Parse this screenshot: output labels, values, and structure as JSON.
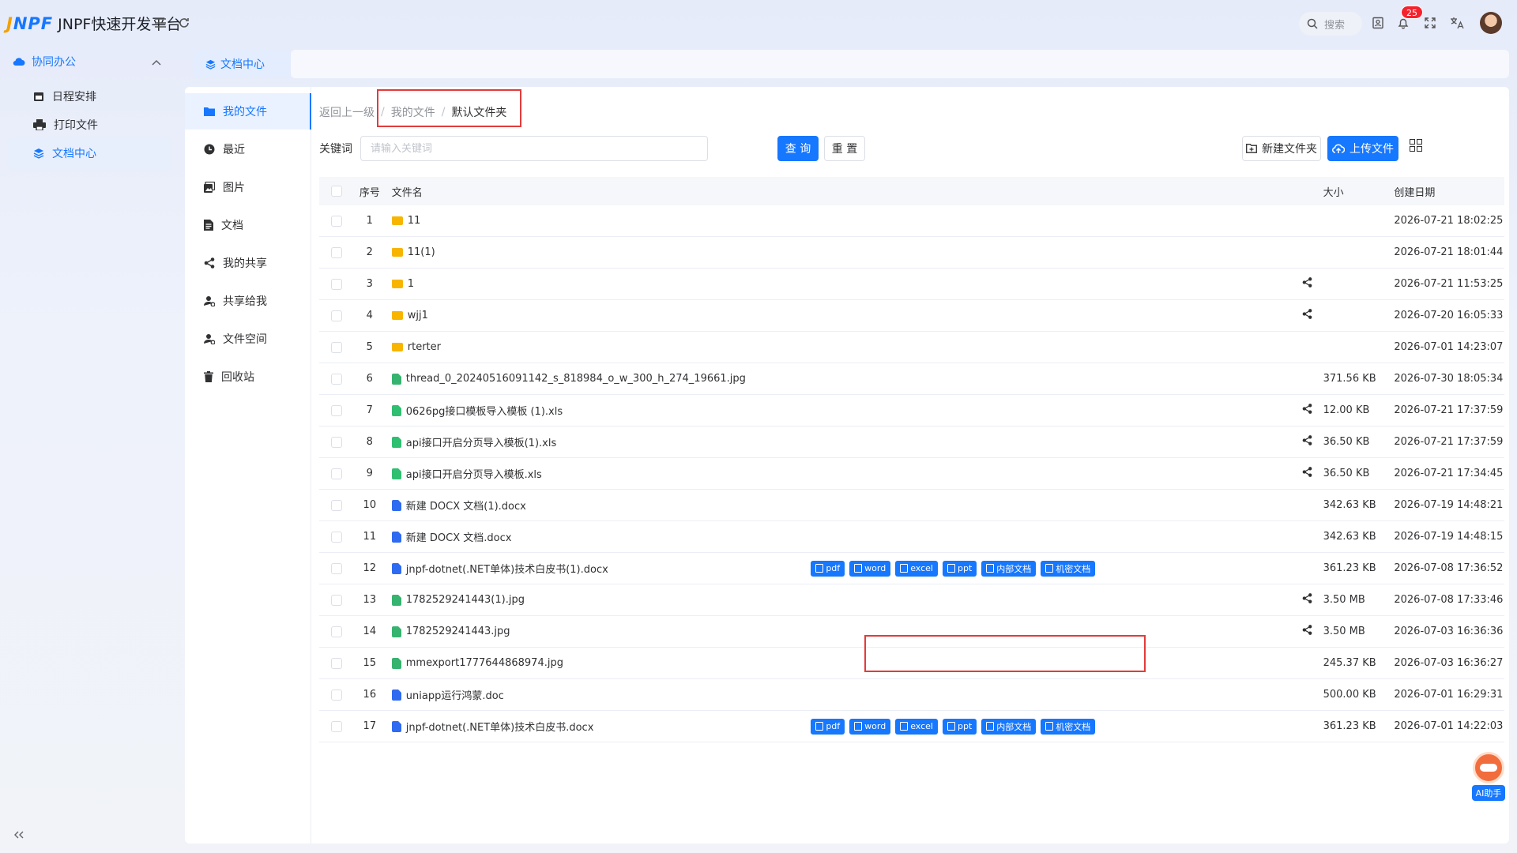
{
  "app": {
    "logo_mark_j": "J",
    "logo_mark_rest": "NPF",
    "title": "JNPF快速开发平台"
  },
  "topbar": {
    "search_placeholder": "搜索",
    "notification_count": "25"
  },
  "nav": {
    "group_label": "协同办公",
    "items": [
      {
        "label": "日程安排"
      },
      {
        "label": "打印文件"
      },
      {
        "label": "文档中心"
      }
    ]
  },
  "tabs": [
    {
      "label": "文档中心"
    }
  ],
  "subnav": [
    {
      "label": "我的文件"
    },
    {
      "label": "最近"
    },
    {
      "label": "图片"
    },
    {
      "label": "文档"
    },
    {
      "label": "我的共享"
    },
    {
      "label": "共享给我"
    },
    {
      "label": "文件空间"
    },
    {
      "label": "回收站"
    }
  ],
  "breadcrumb": {
    "back": "返回上一级",
    "sep": "/",
    "level1": "我的文件",
    "current": "默认文件夹"
  },
  "filter": {
    "label": "关键词",
    "placeholder": "请输入关键词",
    "query": "查 询",
    "reset": "重 置"
  },
  "actions": {
    "new_folder": "新建文件夹",
    "upload": "上传文件"
  },
  "table": {
    "headers": {
      "index": "序号",
      "name": "文件名",
      "size": "大小",
      "date": "创建日期"
    },
    "op_labels": [
      "pdf",
      "word",
      "excel",
      "ppt",
      "内部文档",
      "机密文档"
    ],
    "rows": [
      {
        "idx": "1",
        "type": "folder",
        "name": "11",
        "shared": false,
        "size": "",
        "date": "2026-07-21 18:02:25",
        "ops": false
      },
      {
        "idx": "2",
        "type": "folder",
        "name": "11(1)",
        "shared": false,
        "size": "",
        "date": "2026-07-21 18:01:44",
        "ops": false
      },
      {
        "idx": "3",
        "type": "folder",
        "name": "1",
        "shared": true,
        "size": "",
        "date": "2026-07-21 11:53:25",
        "ops": false
      },
      {
        "idx": "4",
        "type": "folder",
        "name": "wjj1",
        "shared": true,
        "size": "",
        "date": "2026-07-20 16:05:33",
        "ops": false
      },
      {
        "idx": "5",
        "type": "folder",
        "name": "rterter",
        "shared": false,
        "size": "",
        "date": "2026-07-01 14:23:07",
        "ops": false
      },
      {
        "idx": "6",
        "type": "img",
        "name": "thread_0_20240516091142_s_818984_o_w_300_h_274_19661.jpg",
        "shared": false,
        "size": "371.56 KB",
        "date": "2026-07-30 18:05:34",
        "ops": false
      },
      {
        "idx": "7",
        "type": "xls",
        "name": "0626pg接口模板导入模板 (1).xls",
        "shared": true,
        "size": "12.00 KB",
        "date": "2026-07-21 17:37:59",
        "ops": false
      },
      {
        "idx": "8",
        "type": "xls",
        "name": "api接口开启分页导入模板(1).xls",
        "shared": true,
        "size": "36.50 KB",
        "date": "2026-07-21 17:37:59",
        "ops": false
      },
      {
        "idx": "9",
        "type": "xls",
        "name": "api接口开启分页导入模板.xls",
        "shared": true,
        "size": "36.50 KB",
        "date": "2026-07-21 17:34:45",
        "ops": false
      },
      {
        "idx": "10",
        "type": "doc",
        "name": "新建 DOCX 文档(1).docx",
        "shared": false,
        "size": "342.63 KB",
        "date": "2026-07-19 14:48:21",
        "ops": false
      },
      {
        "idx": "11",
        "type": "doc",
        "name": "新建 DOCX 文档.docx",
        "shared": false,
        "size": "342.63 KB",
        "date": "2026-07-19 14:48:15",
        "ops": false
      },
      {
        "idx": "12",
        "type": "doc",
        "name": "jnpf-dotnet(.NET单体)技术白皮书(1).docx",
        "shared": false,
        "size": "361.23 KB",
        "date": "2026-07-08 17:36:52",
        "ops": true
      },
      {
        "idx": "13",
        "type": "img",
        "name": "1782529241443(1).jpg",
        "shared": true,
        "size": "3.50 MB",
        "date": "2026-07-08 17:33:46",
        "ops": false
      },
      {
        "idx": "14",
        "type": "img",
        "name": "1782529241443.jpg",
        "shared": true,
        "size": "3.50 MB",
        "date": "2026-07-03 16:36:36",
        "ops": false
      },
      {
        "idx": "15",
        "type": "img",
        "name": "mmexport1777644868974.jpg",
        "shared": false,
        "size": "245.37 KB",
        "date": "2026-07-03 16:36:27",
        "ops": false
      },
      {
        "idx": "16",
        "type": "doc",
        "name": "uniapp运行鸿蒙.doc",
        "shared": false,
        "size": "500.00 KB",
        "date": "2026-07-01 16:29:31",
        "ops": false
      },
      {
        "idx": "17",
        "type": "doc",
        "name": "jnpf-dotnet(.NET单体)技术白皮书.docx",
        "shared": false,
        "size": "361.23 KB",
        "date": "2026-07-01 14:22:03",
        "ops": true
      }
    ]
  },
  "ai_helper": {
    "label": "AI助手"
  },
  "colors": {
    "primary": "#1677ff",
    "highlight": "#e23b3b",
    "folder": "#f7b500"
  }
}
